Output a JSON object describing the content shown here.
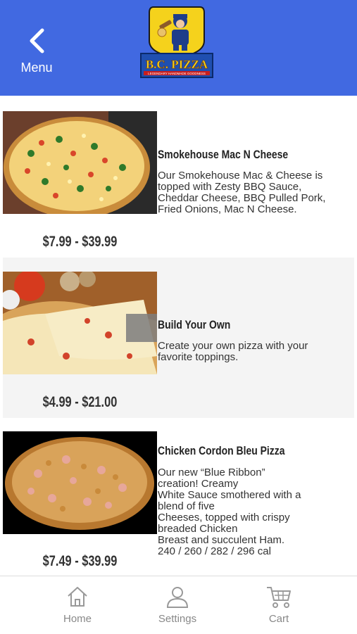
{
  "header": {
    "menu_label": "Menu",
    "logo_text": "B.C. PIZZA",
    "logo_tagline": "LEGENDARY HANDMADE GOODNESS",
    "background": "#4169e1"
  },
  "items": [
    {
      "title": "Smokehouse Mac N Cheese",
      "description": [
        "Our Smokehouse Mac & Cheese is",
        "topped with Zesty BBQ Sauce,",
        "Cheddar Cheese, BBQ Pulled Pork,",
        "Fried Onions, Mac N Cheese."
      ],
      "price": "$7.99 - $39.99",
      "image": "pizza-toppings-photo"
    },
    {
      "title": "Build Your Own",
      "description": [
        "Create your own pizza with your",
        "favorite toppings."
      ],
      "price": "$4.99 - $21.00",
      "image": "cheese-pizza-slice-photo"
    },
    {
      "title": "Chicken Cordon Bleu Pizza",
      "description": [
        "Our new “Blue Ribbon”",
        "creation! Creamy",
        "White Sauce smothered with a",
        "blend of five",
        "Cheeses, topped with crispy",
        "breaded Chicken",
        "Breast and succulent Ham.",
        "240 / 260 / 282 / 296 cal"
      ],
      "price": "$7.49 - $39.99",
      "image": "cordon-bleu-pizza-photo"
    }
  ],
  "tabs": [
    {
      "label": "Home",
      "icon": "home-icon"
    },
    {
      "label": "Settings",
      "icon": "user-icon"
    },
    {
      "label": "Cart",
      "icon": "cart-icon"
    }
  ]
}
